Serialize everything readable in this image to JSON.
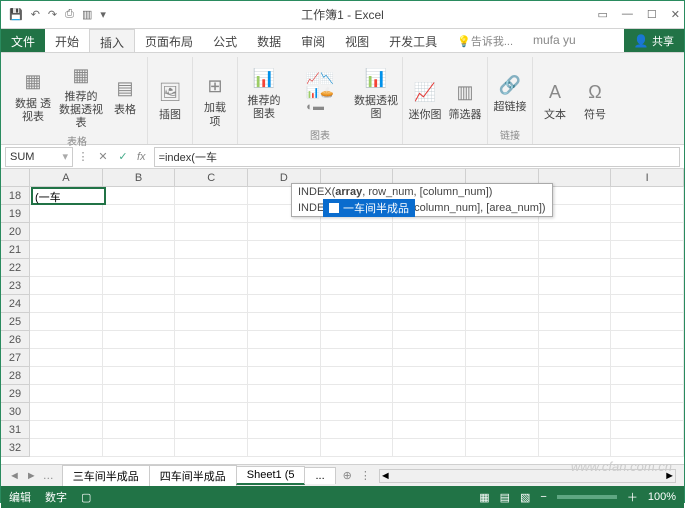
{
  "title": "工作簿1 - Excel",
  "tabs": {
    "file": "文件",
    "items": [
      "开始",
      "插入",
      "页面布局",
      "公式",
      "数据",
      "审阅",
      "视图",
      "开发工具"
    ],
    "activeIndex": 1,
    "tell": "告诉我...",
    "user": "mufa yu",
    "share": "共享"
  },
  "ribbon": {
    "g1": {
      "items": [
        "数据\n透视表",
        "推荐的\n数据透视表",
        "表格"
      ],
      "label": "表格"
    },
    "g2": {
      "items": [
        "插图"
      ],
      "label": ""
    },
    "g3": {
      "items": [
        "加载\n项"
      ],
      "label": ""
    },
    "g4": {
      "items": [
        "推荐的\n图表",
        "",
        "数据透视图"
      ],
      "label": "图表"
    },
    "g5": {
      "items": [
        "迷你图",
        "筛选器"
      ],
      "label": ""
    },
    "g6": {
      "items": [
        "超链接"
      ],
      "label": "链接"
    },
    "g7": {
      "items": [
        "文本",
        "符号"
      ],
      "label": ""
    }
  },
  "namebox": "SUM",
  "formula": "=index(一车",
  "tooltip": {
    "line1_a": "INDEX(",
    "line1_b": "array",
    "line1_c": ", row_num, [column_num])",
    "line2_a": "INDEX",
    "line2_b": "column_num], [area_num])"
  },
  "suggest": "一车间半成品",
  "active_cell_text": "(一车",
  "columns": [
    "A",
    "B",
    "C",
    "D",
    "",
    "",
    "",
    "",
    "I"
  ],
  "row_start": 18,
  "row_count": 15,
  "sheets": {
    "nav": [
      "◄",
      "►"
    ],
    "tabs": [
      "三车间半成品",
      "四车间半成品",
      "Sheet1 (5",
      "..."
    ],
    "active": 2,
    "plus": "⊕"
  },
  "status": {
    "mode": "编辑",
    "extra": "数字",
    "zoom": "100%"
  },
  "watermark": "www.cfan.com.cn"
}
